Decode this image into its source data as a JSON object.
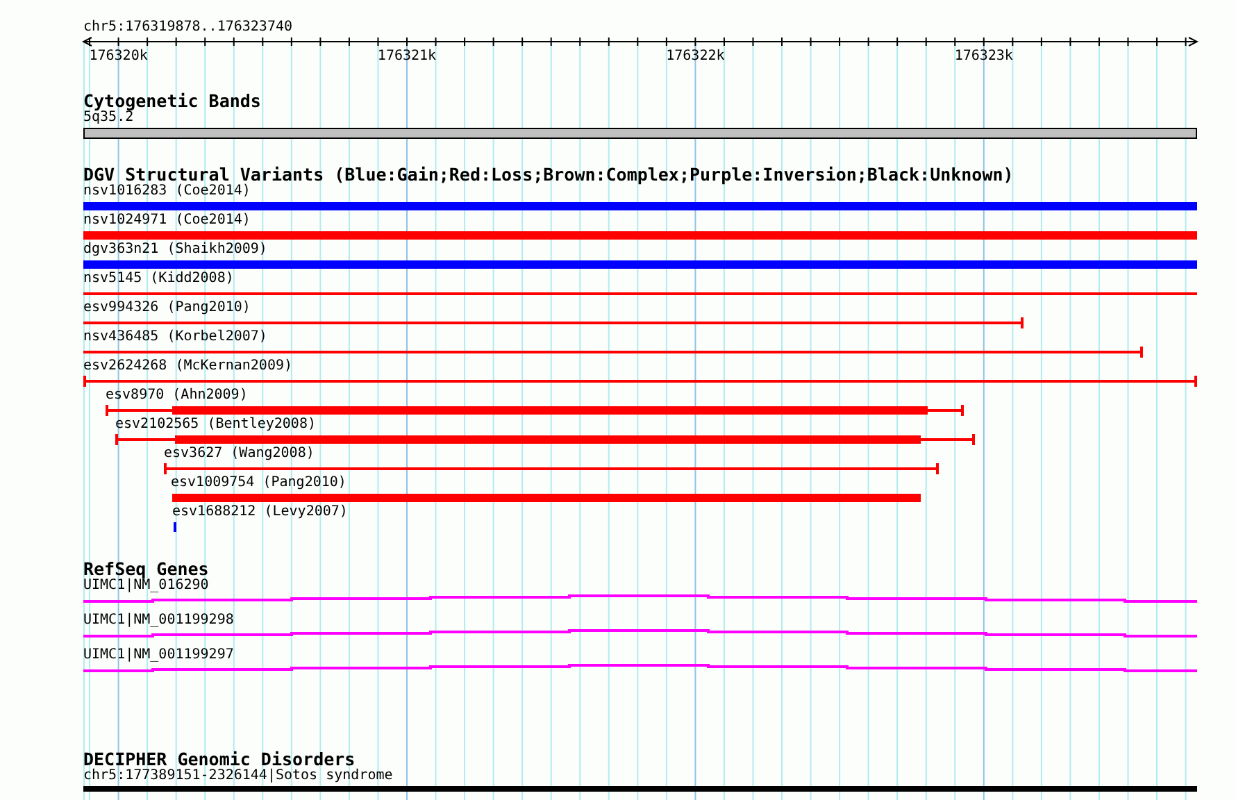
{
  "ruler": {
    "region": "chr5:176319878..176323740",
    "ticks": [
      "176320k",
      "176321k",
      "176322k",
      "176323k"
    ]
  },
  "tracks": [
    {
      "kind": "cytoband",
      "title": "Cytogenetic Bands",
      "features": [
        {
          "label": "5q35.2"
        }
      ]
    },
    {
      "kind": "variants",
      "title": "DGV Structural Variants (Blue:Gain;Red:Loss;Brown:Complex;Purple:Inversion;Black:Unknown)",
      "features": [
        {
          "label": "nsv1016283 (Coe2014)",
          "color": "#0000ff"
        },
        {
          "label": "nsv1024971 (Coe2014)",
          "color": "#ff0000"
        },
        {
          "label": "dgv363n21 (Shaikh2009)",
          "color": "#0000ff"
        },
        {
          "label": "nsv5145 (Kidd2008)",
          "color": "#ff0000"
        },
        {
          "label": "esv994326 (Pang2010)",
          "color": "#ff0000"
        },
        {
          "label": "nsv436485 (Korbel2007)",
          "color": "#ff0000"
        },
        {
          "label": "esv2624268 (McKernan2009)",
          "color": "#ff0000"
        },
        {
          "label": "esv8970 (Ahn2009)",
          "color": "#ff0000"
        },
        {
          "label": "esv2102565 (Bentley2008)",
          "color": "#ff0000"
        },
        {
          "label": "esv3627 (Wang2008)",
          "color": "#ff0000"
        },
        {
          "label": "esv1009754 (Pang2010)",
          "color": "#ff0000"
        },
        {
          "label": "esv1688212 (Levy2007)",
          "color": "#0000ff"
        }
      ]
    },
    {
      "kind": "genes",
      "title": "RefSeq Genes",
      "features": [
        {
          "label": "UIMC1|NM_016290"
        },
        {
          "label": "UIMC1|NM_001199298"
        },
        {
          "label": "UIMC1|NM_001199297"
        }
      ]
    },
    {
      "kind": "disorders",
      "title": "DECIPHER Genomic Disorders",
      "features": [
        {
          "label": "chr5:177389151-2326144|Sotos syndrome"
        }
      ]
    }
  ]
}
